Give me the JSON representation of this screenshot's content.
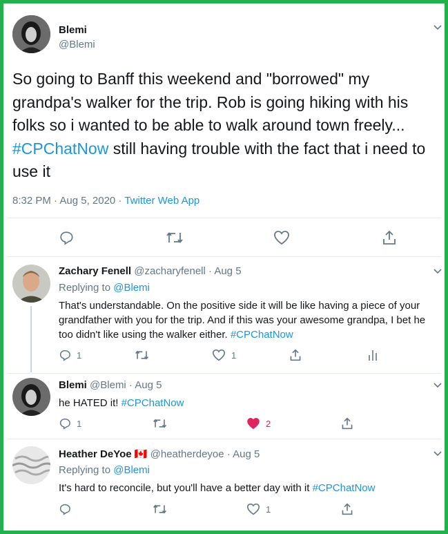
{
  "colors": {
    "accent": "#1b95e0",
    "frame": "#22b14c",
    "like": "#e0245e",
    "muted": "#657786"
  },
  "main_tweet": {
    "name": "Blemi",
    "handle": "@Blemi",
    "text_before": "So going to Banff this weekend and \"borrowed\" my grandpa's walker for the trip. Rob is going hiking with his folks so i wanted to be able to walk around town freely... ",
    "hashtag": "#CPChatNow",
    "text_after": " still having trouble with the fact that i need to use it",
    "timestamp": "8:32 PM · Aug 5, 2020 · ",
    "source": "Twitter Web App",
    "icons": [
      "reply-icon",
      "retweet-icon",
      "like-icon",
      "share-icon"
    ]
  },
  "replies": [
    {
      "name": "Zachary Fenell",
      "handle": "@zacharyfenell",
      "date": " · Aug 5",
      "replying_label": "Replying to ",
      "replying_to": "@Blemi",
      "text": "That's understandable. On the positive side it will be like having a piece of your grandfather with you for the trip. And if this was your awesome grandpa, I bet he too didn't like using the walker either. ",
      "hashtag": "#CPChatNow",
      "reply_count": "1",
      "like_count": "1"
    },
    {
      "name": "Blemi",
      "handle": "@Blemi",
      "date": " · Aug 5",
      "text": "he HATED it! ",
      "hashtag": "#CPChatNow",
      "reply_count": "1",
      "like_count": "2",
      "liked": true
    },
    {
      "name": "Heather DeYoe",
      "flag": "🇨🇦",
      "handle": "@heatherdeyoe",
      "date": " · Aug 5",
      "replying_label": "Replying to ",
      "replying_to": "@Blemi",
      "text": "It's hard to reconcile, but you'll have a better day with it ",
      "hashtag": "#CPChatNow",
      "like_count": "1"
    }
  ]
}
